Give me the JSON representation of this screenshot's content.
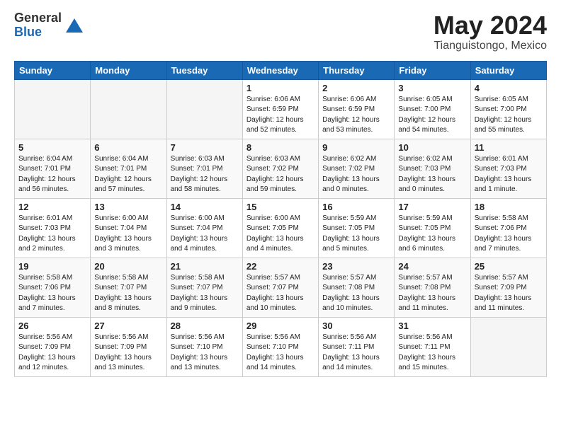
{
  "header": {
    "logo_general": "General",
    "logo_blue": "Blue",
    "title": "May 2024",
    "location": "Tianguistongo, Mexico"
  },
  "weekdays": [
    "Sunday",
    "Monday",
    "Tuesday",
    "Wednesday",
    "Thursday",
    "Friday",
    "Saturday"
  ],
  "weeks": [
    [
      {
        "day": "",
        "info": ""
      },
      {
        "day": "",
        "info": ""
      },
      {
        "day": "",
        "info": ""
      },
      {
        "day": "1",
        "info": "Sunrise: 6:06 AM\nSunset: 6:59 PM\nDaylight: 12 hours\nand 52 minutes."
      },
      {
        "day": "2",
        "info": "Sunrise: 6:06 AM\nSunset: 6:59 PM\nDaylight: 12 hours\nand 53 minutes."
      },
      {
        "day": "3",
        "info": "Sunrise: 6:05 AM\nSunset: 7:00 PM\nDaylight: 12 hours\nand 54 minutes."
      },
      {
        "day": "4",
        "info": "Sunrise: 6:05 AM\nSunset: 7:00 PM\nDaylight: 12 hours\nand 55 minutes."
      }
    ],
    [
      {
        "day": "5",
        "info": "Sunrise: 6:04 AM\nSunset: 7:01 PM\nDaylight: 12 hours\nand 56 minutes."
      },
      {
        "day": "6",
        "info": "Sunrise: 6:04 AM\nSunset: 7:01 PM\nDaylight: 12 hours\nand 57 minutes."
      },
      {
        "day": "7",
        "info": "Sunrise: 6:03 AM\nSunset: 7:01 PM\nDaylight: 12 hours\nand 58 minutes."
      },
      {
        "day": "8",
        "info": "Sunrise: 6:03 AM\nSunset: 7:02 PM\nDaylight: 12 hours\nand 59 minutes."
      },
      {
        "day": "9",
        "info": "Sunrise: 6:02 AM\nSunset: 7:02 PM\nDaylight: 13 hours\nand 0 minutes."
      },
      {
        "day": "10",
        "info": "Sunrise: 6:02 AM\nSunset: 7:03 PM\nDaylight: 13 hours\nand 0 minutes."
      },
      {
        "day": "11",
        "info": "Sunrise: 6:01 AM\nSunset: 7:03 PM\nDaylight: 13 hours\nand 1 minute."
      }
    ],
    [
      {
        "day": "12",
        "info": "Sunrise: 6:01 AM\nSunset: 7:03 PM\nDaylight: 13 hours\nand 2 minutes."
      },
      {
        "day": "13",
        "info": "Sunrise: 6:00 AM\nSunset: 7:04 PM\nDaylight: 13 hours\nand 3 minutes."
      },
      {
        "day": "14",
        "info": "Sunrise: 6:00 AM\nSunset: 7:04 PM\nDaylight: 13 hours\nand 4 minutes."
      },
      {
        "day": "15",
        "info": "Sunrise: 6:00 AM\nSunset: 7:05 PM\nDaylight: 13 hours\nand 4 minutes."
      },
      {
        "day": "16",
        "info": "Sunrise: 5:59 AM\nSunset: 7:05 PM\nDaylight: 13 hours\nand 5 minutes."
      },
      {
        "day": "17",
        "info": "Sunrise: 5:59 AM\nSunset: 7:05 PM\nDaylight: 13 hours\nand 6 minutes."
      },
      {
        "day": "18",
        "info": "Sunrise: 5:58 AM\nSunset: 7:06 PM\nDaylight: 13 hours\nand 7 minutes."
      }
    ],
    [
      {
        "day": "19",
        "info": "Sunrise: 5:58 AM\nSunset: 7:06 PM\nDaylight: 13 hours\nand 7 minutes."
      },
      {
        "day": "20",
        "info": "Sunrise: 5:58 AM\nSunset: 7:07 PM\nDaylight: 13 hours\nand 8 minutes."
      },
      {
        "day": "21",
        "info": "Sunrise: 5:58 AM\nSunset: 7:07 PM\nDaylight: 13 hours\nand 9 minutes."
      },
      {
        "day": "22",
        "info": "Sunrise: 5:57 AM\nSunset: 7:07 PM\nDaylight: 13 hours\nand 10 minutes."
      },
      {
        "day": "23",
        "info": "Sunrise: 5:57 AM\nSunset: 7:08 PM\nDaylight: 13 hours\nand 10 minutes."
      },
      {
        "day": "24",
        "info": "Sunrise: 5:57 AM\nSunset: 7:08 PM\nDaylight: 13 hours\nand 11 minutes."
      },
      {
        "day": "25",
        "info": "Sunrise: 5:57 AM\nSunset: 7:09 PM\nDaylight: 13 hours\nand 11 minutes."
      }
    ],
    [
      {
        "day": "26",
        "info": "Sunrise: 5:56 AM\nSunset: 7:09 PM\nDaylight: 13 hours\nand 12 minutes."
      },
      {
        "day": "27",
        "info": "Sunrise: 5:56 AM\nSunset: 7:09 PM\nDaylight: 13 hours\nand 13 minutes."
      },
      {
        "day": "28",
        "info": "Sunrise: 5:56 AM\nSunset: 7:10 PM\nDaylight: 13 hours\nand 13 minutes."
      },
      {
        "day": "29",
        "info": "Sunrise: 5:56 AM\nSunset: 7:10 PM\nDaylight: 13 hours\nand 14 minutes."
      },
      {
        "day": "30",
        "info": "Sunrise: 5:56 AM\nSunset: 7:11 PM\nDaylight: 13 hours\nand 14 minutes."
      },
      {
        "day": "31",
        "info": "Sunrise: 5:56 AM\nSunset: 7:11 PM\nDaylight: 13 hours\nand 15 minutes."
      },
      {
        "day": "",
        "info": ""
      }
    ]
  ]
}
